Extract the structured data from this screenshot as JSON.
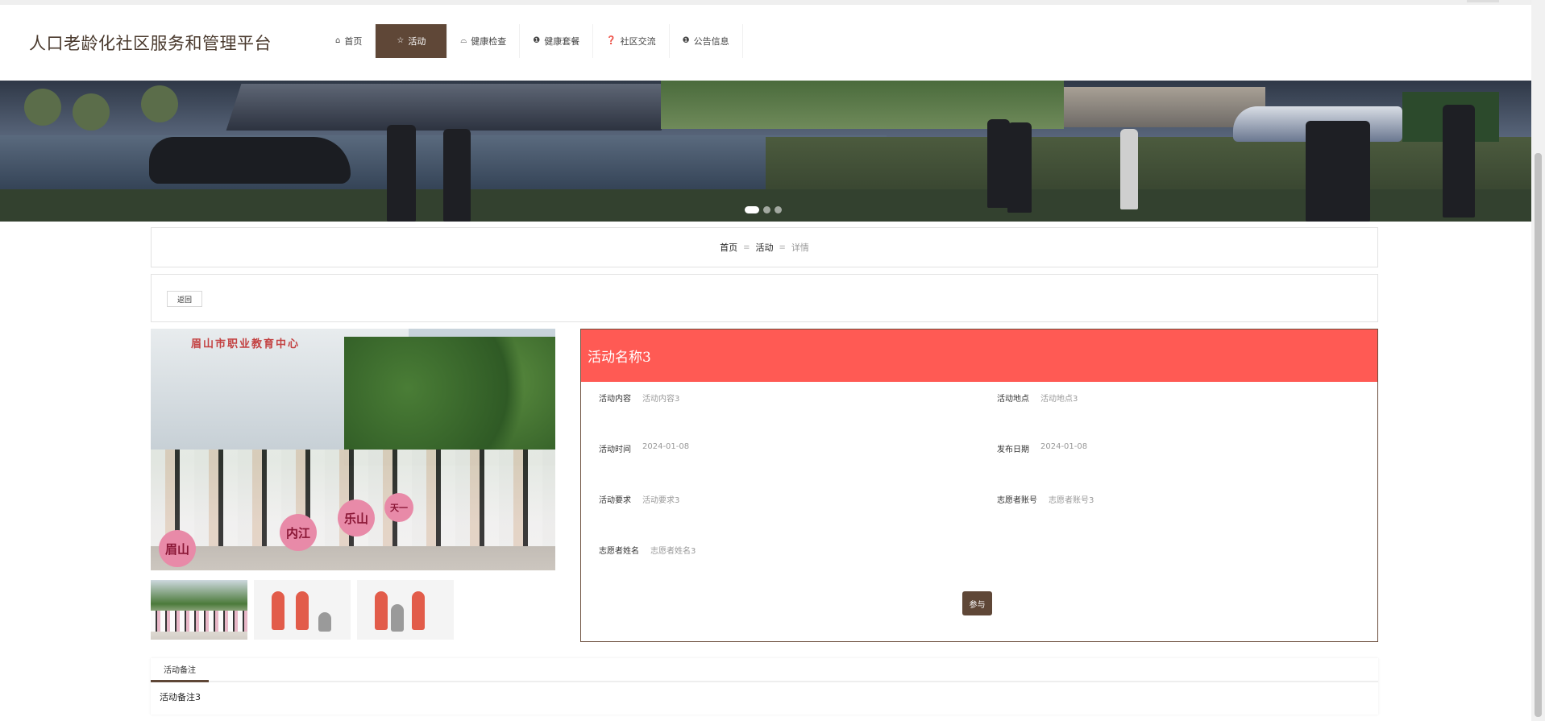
{
  "site": {
    "title": "人口老龄化社区服务和管理平台"
  },
  "nav": [
    {
      "label": "首页",
      "icon": "home-icon",
      "glyph": "⌂"
    },
    {
      "label": "活动",
      "icon": "star-icon",
      "glyph": "☆",
      "active": true
    },
    {
      "label": "健康检查",
      "icon": "bag-icon",
      "glyph": "⌓"
    },
    {
      "label": "健康套餐",
      "icon": "info-icon",
      "glyph": "❶"
    },
    {
      "label": "社区交流",
      "icon": "question-icon",
      "glyph": "❓"
    },
    {
      "label": "公告信息",
      "icon": "info-icon",
      "glyph": "❶"
    }
  ],
  "banner": {
    "slides": 3,
    "active_slide": 1
  },
  "breadcrumb": {
    "home": "首页",
    "section": "活动",
    "current": "详情",
    "separator": "≡"
  },
  "back_button": "返回",
  "activity": {
    "name": "活动名称3",
    "fields": {
      "content": {
        "label": "活动内容",
        "value": "活动内容3"
      },
      "location": {
        "label": "活动地点",
        "value": "活动地点3"
      },
      "time": {
        "label": "活动时间",
        "value": "2024-01-08"
      },
      "publish_date": {
        "label": "发布日期",
        "value": "2024-01-08"
      },
      "requirement": {
        "label": "活动要求",
        "value": "活动要求3"
      },
      "volunteer_account": {
        "label": "志愿者账号",
        "value": "志愿者账号3"
      },
      "volunteer_name": {
        "label": "志愿者姓名",
        "value": "志愿者姓名3"
      }
    },
    "join_button": "参与"
  },
  "gallery": {
    "main_signs": [
      "眉山",
      "内江",
      "乐山",
      "天一"
    ],
    "main_banner": "眉山市职业教育中心"
  },
  "tabs": [
    {
      "label": "活动备注",
      "content": "活动备注3"
    }
  ],
  "colors": {
    "brand": "#5f4737",
    "title_bar": "#ff5a54",
    "panel_border": "#6b4e3d"
  }
}
